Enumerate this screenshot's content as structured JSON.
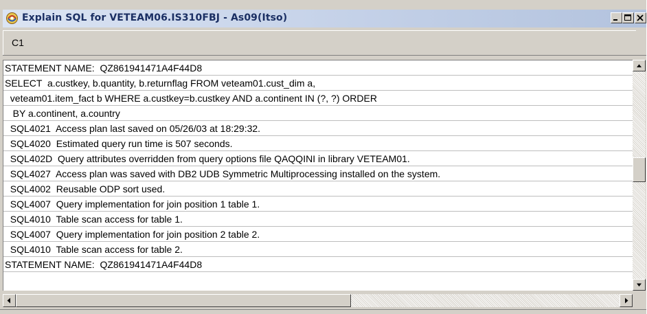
{
  "window": {
    "title": "Explain SQL for  VETEAM06.IS310FBJ - As09(Itso)",
    "icon": "sql-explain-app-icon",
    "buttons": [
      "minimize",
      "maximize",
      "close"
    ]
  },
  "table": {
    "column_header": "C1",
    "rows": [
      "STATEMENT NAME:  QZ861941471A4F44D8",
      "SELECT  a.custkey, b.quantity, b.returnflag FROM veteam01.cust_dim a,",
      "  veteam01.item_fact b WHERE a.custkey=b.custkey AND a.continent IN (?, ?) ORDER",
      "   BY a.continent, a.country",
      "  SQL4021  Access plan last saved on 05/26/03 at 18:29:32.",
      "  SQL4020  Estimated query run time is 507 seconds.",
      "  SQL402D  Query attributes overridden from query options file QAQQINI in library VETEAM01.",
      "  SQL4027  Access plan was saved with DB2 UDB Symmetric Multiprocessing installed on the system.",
      "  SQL4002  Reusable ODP sort used.",
      "  SQL4007  Query implementation for join position 1 table 1.",
      "  SQL4010  Table scan access for table 1.",
      "  SQL4007  Query implementation for join position 2 table 2.",
      "  SQL4010  Table scan access for table 2."
    ]
  },
  "colors": {
    "window_face": "#d4d0c8",
    "titlebar_text": "#1b2f63",
    "titlebar_bg": "#c4d1e8",
    "list_bg": "#ffffff"
  }
}
